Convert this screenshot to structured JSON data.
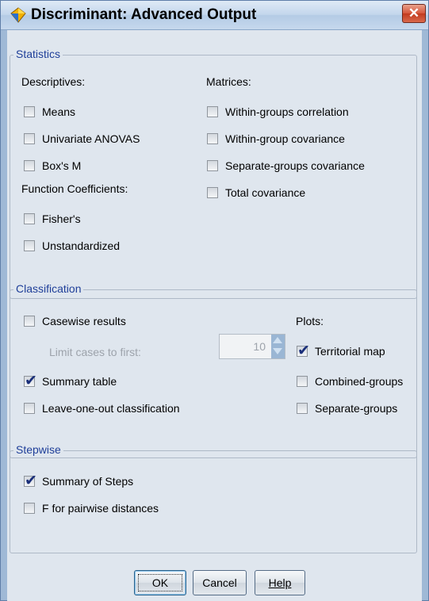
{
  "window": {
    "title": "Discriminant: Advanced Output",
    "close_glyph": "✕",
    "icon": "diamond-app-icon"
  },
  "statistics": {
    "legend": "Statistics",
    "descriptives_heading": "Descriptives:",
    "means": {
      "label": "Means",
      "checked": false
    },
    "univariate": {
      "label": "Univariate ANOVAS",
      "checked": false
    },
    "boxm": {
      "label": "Box's M",
      "checked": false
    },
    "function_heading": "Function Coefficients:",
    "fishers": {
      "label": "Fisher's",
      "checked": false
    },
    "unstandardized": {
      "label": "Unstandardized",
      "checked": false
    },
    "matrices_heading": "Matrices:",
    "within_corr": {
      "label": "Within-groups correlation",
      "checked": false
    },
    "within_cov": {
      "label": "Within-group covariance",
      "checked": false
    },
    "separate_cov": {
      "label": "Separate-groups covariance",
      "checked": false
    },
    "total_cov": {
      "label": "Total covariance",
      "checked": false
    }
  },
  "classification": {
    "legend": "Classification",
    "casewise": {
      "label": "Casewise results",
      "checked": false
    },
    "limit_label": "Limit cases to first:",
    "limit_value": "10",
    "summary_table": {
      "label": "Summary table",
      "checked": true
    },
    "leave_one_out": {
      "label": "Leave-one-out classification",
      "checked": false
    },
    "plots_heading": "Plots:",
    "territorial": {
      "label": "Territorial map",
      "checked": true
    },
    "combined": {
      "label": "Combined-groups",
      "checked": false
    },
    "separate": {
      "label": "Separate-groups",
      "checked": false
    }
  },
  "stepwise": {
    "legend": "Stepwise",
    "summary_steps": {
      "label": "Summary of Steps",
      "checked": true
    },
    "f_pairwise": {
      "label": "F for pairwise distances",
      "checked": false
    }
  },
  "buttons": {
    "ok": "OK",
    "cancel": "Cancel",
    "help": "Help"
  },
  "colors": {
    "legend_text": "#1f3f99",
    "panel_bg": "#dfe6ee",
    "frame_bg": "#9fb9d6",
    "close_red": "#d5553a"
  }
}
